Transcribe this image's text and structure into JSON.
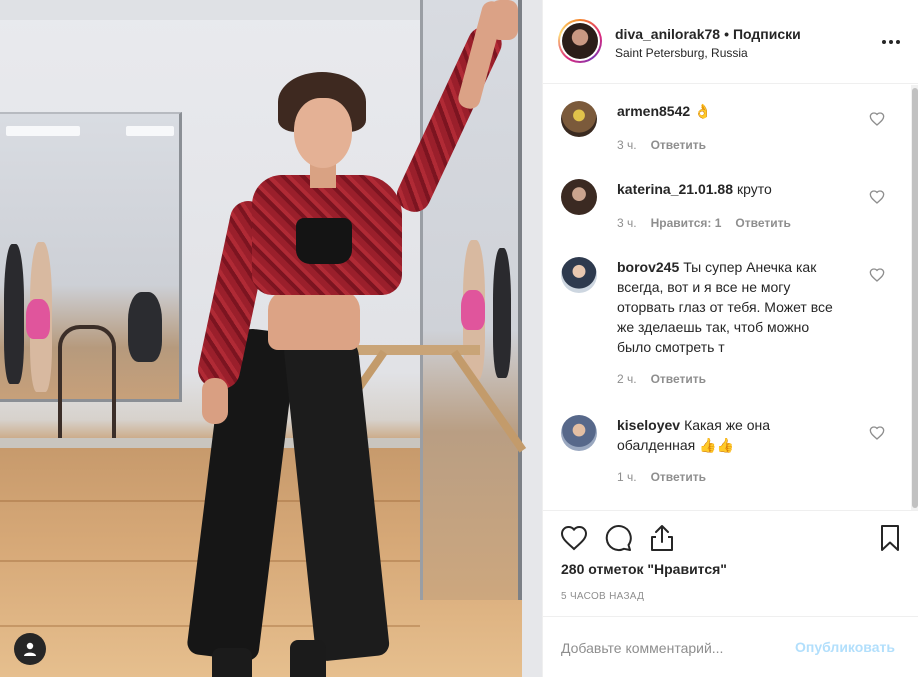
{
  "post": {
    "username": "diva_anilorak78",
    "separator": "•",
    "follow_label": "Подписки",
    "location": "Saint Petersburg, Russia",
    "more_icon": "more-horizontal-icon",
    "photo_alt": "woman in red plaid shirt and black leggings in dance studio"
  },
  "comments": [
    {
      "user": "armen8542",
      "text": "👌",
      "time": "3 ч.",
      "likes": "",
      "reply": "Ответить",
      "avatar_color": "#5a3b2a"
    },
    {
      "user": "katerina_21.01.88",
      "text": "круто",
      "time": "3 ч.",
      "likes": "Нравится: 1",
      "reply": "Ответить",
      "avatar_color": "#4a3a30"
    },
    {
      "user": "borov245",
      "text": "Ты супер Анечка как всегда, вот и я все не могу оторвать глаз от тебя. Может все же зделаешь так, чтоб можно было смотреть т",
      "time": "2 ч.",
      "likes": "",
      "reply": "Ответить",
      "avatar_color": "#b7c4d3"
    },
    {
      "user": "kiseloyev",
      "text": "Какая же она обалденная 👍👍",
      "time": "1 ч.",
      "likes": "",
      "reply": "Ответить",
      "avatar_color": "#6b7a96"
    }
  ],
  "actions": {
    "like_icon": "heart-icon",
    "comment_icon": "comment-icon",
    "share_icon": "share-icon",
    "save_icon": "bookmark-icon"
  },
  "likes_text": "280 отметок \"Нравится\"",
  "time_ago": "5 часов назад",
  "add_comment": {
    "placeholder": "Добавьте комментарий...",
    "publish_label": "Опубликовать",
    "publish_color": "#b2dffc"
  },
  "colors": {
    "text": "#262626",
    "muted": "#8e8e8e",
    "border": "#efefef"
  }
}
